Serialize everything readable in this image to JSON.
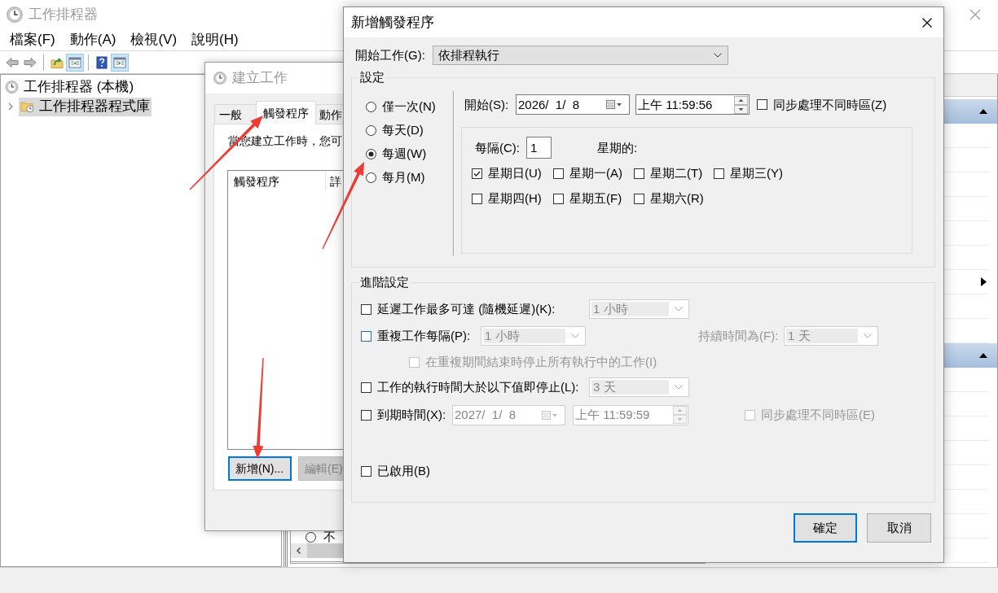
{
  "main_window": {
    "title": "工作排程器",
    "active": false,
    "menu": [
      "檔案(F)",
      "動作(A)",
      "檢視(V)",
      "說明(H)"
    ],
    "toolbar": [
      {
        "disabled": true,
        "pressed": false
      },
      {
        "disabled": true,
        "pressed": false
      },
      {
        "disabled": false,
        "pressed": false
      },
      {
        "disabled": false,
        "pressed": true
      },
      {
        "disabled": false,
        "pressed": false
      },
      {
        "disabled": false,
        "pressed": true
      }
    ],
    "tree": [
      {
        "label": "工作排程器 (本機)",
        "selected": false,
        "children": [
          {
            "label": "工作排程器程式庫",
            "selected": true,
            "expanded": false
          }
        ]
      }
    ],
    "middle_pane": {
      "radio": {
        "label": "不",
        "selected": false
      }
    },
    "action_pane": {
      "sections": [
        {
          "expanded": true,
          "items": [
            {
              "submenu": false
            },
            {
              "submenu": false
            },
            {
              "submenu": false
            },
            {
              "submenu": false
            },
            {
              "submenu": false
            },
            {
              "submenu": false
            },
            {
              "submenu": true
            },
            {
              "submenu": false
            },
            {
              "submenu": false
            }
          ]
        },
        {
          "expanded": true,
          "items": [
            {
              "submenu": false
            },
            {
              "submenu": false
            },
            {
              "submenu": false
            },
            {
              "submenu": false
            },
            {
              "submenu": false
            },
            {
              "submenu": false
            },
            {
              "submenu": false
            },
            {
              "submenu": false
            }
          ]
        }
      ]
    }
  },
  "create_task": {
    "title": "建立工作",
    "active": false,
    "tabs": [
      {
        "label": "一般",
        "selected": false
      },
      {
        "label": "觸發程序",
        "selected": true
      },
      {
        "label": "動作",
        "selected": false
      }
    ],
    "intro": "當您建立工作時，您可",
    "trigger_list": {
      "columns": [
        "觸發程序",
        "詳"
      ]
    },
    "buttons": [
      {
        "label": "新增(N)...",
        "focused": true,
        "disabled": false
      },
      {
        "label": "編輯(E)",
        "focused": false,
        "disabled": true
      }
    ]
  },
  "new_trigger": {
    "title": "新增觸發程序",
    "active": true,
    "begin_task": {
      "label": "開始工作(G):",
      "value": "依排程執行"
    },
    "settings": {
      "title": "設定",
      "schedule_types": [
        {
          "label": "僅一次(N)",
          "selected": false
        },
        {
          "label": "每天(D)",
          "selected": false
        },
        {
          "label": "每週(W)",
          "selected": true
        },
        {
          "label": "每月(M)",
          "selected": false
        }
      ],
      "start": {
        "label": "開始(S):",
        "date": {
          "value": "2026/  1/  8"
        },
        "time": {
          "value": "上午 11:59:56"
        }
      },
      "sync_time_zones": {
        "label": "同步處理不同時區(Z)",
        "checked": false
      },
      "recur": {
        "label": "每隔(C):",
        "value": "1",
        "unit_label": "星期的:"
      },
      "weekdays": [
        {
          "label": "星期日(U)",
          "checked": true
        },
        {
          "label": "星期一(A)",
          "checked": false
        },
        {
          "label": "星期二(T)",
          "checked": false
        },
        {
          "label": "星期三(Y)",
          "checked": false
        },
        {
          "label": "星期四(H)",
          "checked": false
        },
        {
          "label": "星期五(F)",
          "checked": false
        },
        {
          "label": "星期六(R)",
          "checked": false
        }
      ]
    },
    "advanced": {
      "title": "進階設定",
      "delay": {
        "label": "延遲工作最多可達 (隨機延遲)(K):",
        "checked": false,
        "dropdown": {
          "value": "1 小時",
          "disabled": true
        }
      },
      "repeat": {
        "label": "重複工作每隔(P):",
        "checked": false,
        "focused": true,
        "dropdown": {
          "value": "1 小時",
          "disabled": true
        },
        "duration": {
          "label": "持續時間為(F):",
          "value": "1 天",
          "disabled": true
        }
      },
      "stop_at_end": {
        "label": "在重複期間結束時停止所有執行中的工作(I)",
        "checked": false,
        "disabled": true
      },
      "stop_if_longer": {
        "label": "工作的執行時間大於以下值即停止(L):",
        "checked": false,
        "dropdown": {
          "value": "3 天",
          "disabled": true
        }
      },
      "expire": {
        "label": "到期時間(X):",
        "checked": false,
        "date": {
          "value": "2027/  1/  8",
          "disabled": true
        },
        "time": {
          "value": "上午 11:59:59",
          "disabled": true
        },
        "sync": {
          "label": "同步處理不同時區(E)",
          "checked": false,
          "disabled": true
        }
      },
      "enabled": {
        "label": "已啟用(B)",
        "checked": false
      }
    },
    "buttons": [
      {
        "label": "確定",
        "default": true
      },
      {
        "label": "取消",
        "default": false
      }
    ]
  },
  "annotations": [
    {
      "kind": "arrow"
    },
    {
      "kind": "arrow"
    },
    {
      "kind": "arrow"
    }
  ]
}
